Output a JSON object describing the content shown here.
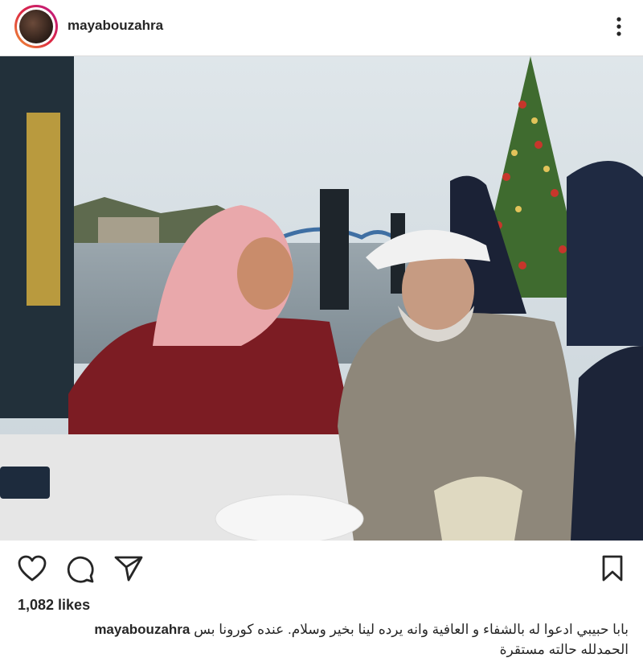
{
  "post": {
    "username": "mayabouzahra",
    "likes": "1,082 likes",
    "caption_user": "mayabouzahra",
    "caption_text": "بابا حبيبي ادعوا له بالشفاء و العافية وانه يرده لينا بخير وسلام. عنده كورونا بس",
    "caption_text_line2": "الحمدلله حالته مستقرة"
  },
  "icons": {
    "more": "more-options-icon",
    "like": "heart-icon",
    "comment": "comment-icon",
    "share": "share-icon",
    "save": "bookmark-icon"
  },
  "colors": {
    "text": "#262626",
    "divider": "#dbdbdb"
  }
}
